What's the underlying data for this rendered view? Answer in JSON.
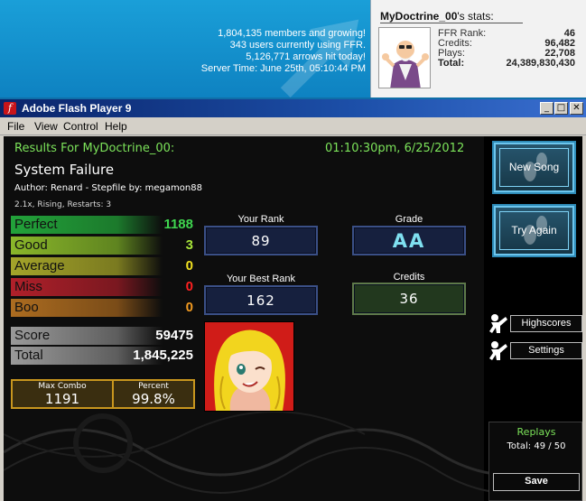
{
  "banner": {
    "stats_lines": [
      "1,804,135 members and growing!",
      "343 users currently using FFR.",
      "5,126,771 arrows hit today!",
      "Server Time: June 25th, 05:10:44 PM"
    ]
  },
  "user_panel": {
    "username": "MyDoctrine_00",
    "title_suffix": "'s stats:",
    "stats": [
      {
        "label": "FFR Rank:",
        "value": "46"
      },
      {
        "label": "Credits:",
        "value": "96,482"
      },
      {
        "label": "Plays:",
        "value": "22,708"
      },
      {
        "label": "Total:",
        "value": "24,389,830,430"
      }
    ]
  },
  "window": {
    "title": "Adobe Flash Player 9",
    "icon_glyph": "f",
    "menus": [
      "File",
      "View",
      "Control",
      "Help"
    ],
    "btn_min": "_",
    "btn_max": "□",
    "btn_close": "✕"
  },
  "results": {
    "header": "Results For MyDoctrine_00:",
    "datetime": "01:10:30pm, 6/25/2012",
    "song_title": "System Failure",
    "author_line": "Author: Renard   -   Stepfile by: megamon88",
    "mods_line": "2.1x, Rising, Restarts: 3",
    "judgements": [
      {
        "label": "Perfect",
        "value": "1188",
        "color": "#24a83a",
        "value_color": "#3fd64f"
      },
      {
        "label": "Good",
        "value": "3",
        "color": "#8ab62a",
        "value_color": "#a8e53a"
      },
      {
        "label": "Average",
        "value": "0",
        "color": "#a2a22a",
        "value_color": "#f0e020"
      },
      {
        "label": "Miss",
        "value": "0",
        "color": "#a8202a",
        "value_color": "#ff2020"
      },
      {
        "label": "Boo",
        "value": "0",
        "color": "#a86a20",
        "value_color": "#f29a20"
      }
    ],
    "score_label": "Score",
    "score_value": "59475",
    "total_label": "Total",
    "total_value": "1,845,225",
    "max_combo_label": "Max Combo",
    "max_combo_value": "1191",
    "percent_label": "Percent",
    "percent_value": "99.8%",
    "your_rank_label": "Your Rank",
    "your_rank_value": "89",
    "grade_label": "Grade",
    "grade_value": "AA",
    "best_rank_label": "Your Best Rank",
    "best_rank_value": "162",
    "credits_label": "Credits",
    "credits_value": "36"
  },
  "sidebar": {
    "new_song": "New Song",
    "try_again": "Try Again",
    "highscores": "Highscores",
    "settings": "Settings",
    "replays_title": "Replays",
    "replays_total": "Total: 49 / 50",
    "save": "Save"
  },
  "colors": {
    "accent_green": "#7ce35a",
    "panel_blue": "#16203e",
    "sidebar_cyan": "#6cc6ee"
  }
}
